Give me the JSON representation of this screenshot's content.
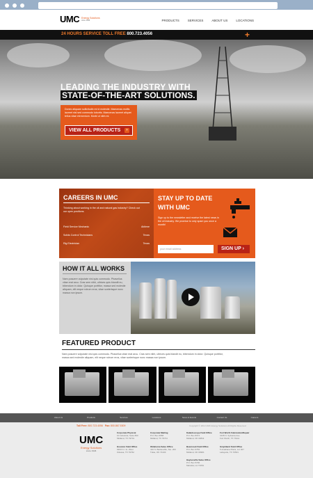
{
  "nav": {
    "items": [
      "Products",
      "Services",
      "About Us",
      "Locations"
    ]
  },
  "topbar": {
    "service_text": "24 HOURS SERVICE TOLL FREE",
    "phone": "800.723.4056"
  },
  "logo": {
    "name": "UMC",
    "tagline": "Energy Solutions",
    "since": "since 1946"
  },
  "hero": {
    "line1": "LEADING THE INDUSTRY WITH",
    "line2": "STATE-OF-THE-ART SOLUTIONS.",
    "body": "Donec aliquam sollicitudin mi id molestie. Maecenas mollis laoreet nisl sed commodo lobortis. Maecenas laoreet aliquet tellus vitae elementum. Morbi ut nibh mi.",
    "cta": "VIEW ALL PRODUCTS"
  },
  "careers": {
    "title": "CAREERS IN UMC",
    "intro": "Thinking about working in the oil and natural gas industry? Check out our open positions.",
    "jobs": [
      {
        "title": "Field Service Mechanic",
        "location": "Abilene"
      },
      {
        "title": "Solids Control Technicians",
        "location": "Texas"
      },
      {
        "title": "Rig Electrician",
        "location": "Texas"
      }
    ]
  },
  "newsletter": {
    "title": "STAY UP TO DATE WITH UMC",
    "body": "Sign up to the newsletter and receive the latest news in the oil industry. We promise to only spam you once a month!",
    "email_placeholder": "your email address",
    "signup": "SIGN UP"
  },
  "how": {
    "title": "HOW IT ALL WORKS",
    "body": "Nam posuere vulputate nisi quis commodo. Phasellus vitae erat arcu. Cras sem nibh, ultrices quis blandit eu, bibendum in dolor. Quisque porttitor, massa sed molestie aliquam, elit neque rutrum eros, vitae scelerisque nunc massa non ipsum."
  },
  "featured": {
    "title": "FEATURED PRODUCT",
    "body": "Nam posuere vulputate nisi quis commodo. Phasellus vitae erat arcu. Cras sem nibh, ultrices quis blandit eu, bibendum in dolor. Quisque porttitor, massa sed molestie aliquam, elit neque rutrum eros, vitae scelerisque nunc massa non ipsum."
  },
  "footer": {
    "nav": [
      "About Us",
      "Products",
      "Services",
      "Locations",
      "News & Events",
      "Contact Us",
      "Careers"
    ],
    "toll_free_label": "Toll Free:",
    "toll_free": "800.723.4056",
    "fax_label": "Fax:",
    "fax": "800.867.5309",
    "copyright": "Copyright © 2013 UMC Energy Solutions All Rights Reserved",
    "offices": [
      {
        "name": "Corporate Physical",
        "line1": "10 Industrial, Suite 800",
        "line2": "Midland, TX 79701"
      },
      {
        "name": "Corporate Mailing",
        "line1": "P.O. Box 6958",
        "line2": "Midland, TX 79711"
      },
      {
        "name": "Kalaidoscope Field Office",
        "line1": "P.O. Box 8374",
        "line2": "Midland, OK 00811"
      },
      {
        "name": "Fort Worth Fabrication/Repair",
        "line1": "3135 N. Sylvania Ave.",
        "line2": "Fort Worth, TX 76111"
      },
      {
        "name": "Houston Field Office",
        "line1": "9363 N. I.H. West",
        "line2": "Odessa, TX 79762"
      },
      {
        "name": "Oklahoma Sales Office",
        "line1": "410 S. Bartlesville, Ste. 203",
        "line2": "Tulsa, OK 74103"
      },
      {
        "name": "Bearcreek Field Office",
        "line1": "P.O. Box 9784",
        "line2": "Midland, OK 00901"
      },
      {
        "name": "Graphland Field Office",
        "line1": "5 Acadiana Plaza, Lot 407",
        "line2": "Lafayette, TX 70501"
      },
      {
        "name": "Haynesville Sales Office",
        "line1": "P.O. Box 5706",
        "line2": "Marietta, LA 71061"
      }
    ]
  },
  "colors": {
    "accent": "#e55a1c",
    "dark_red": "#b82216",
    "black": "#111111"
  }
}
